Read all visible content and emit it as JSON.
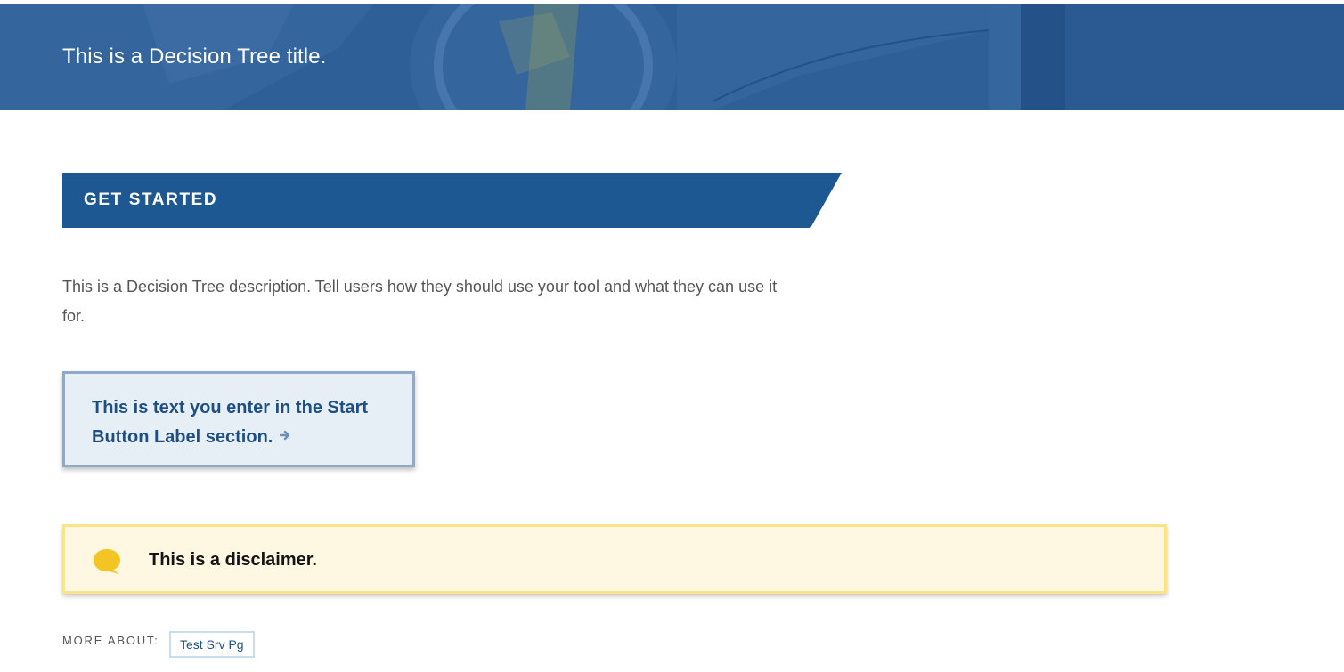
{
  "header": {
    "title": "This is a Decision Tree title."
  },
  "section_banner": {
    "label": "GET STARTED"
  },
  "description": "This is a Decision Tree description. Tell users how they should use your tool and what they can use it for.",
  "start_button": {
    "label": "This is text you enter in the Start Button Label section.",
    "icon": "arrow-right-icon"
  },
  "disclaimer": {
    "text": "This is a disclaimer.",
    "icon": "speech-bubble-icon"
  },
  "more_about": {
    "label": "MORE ABOUT:",
    "tags": [
      "Test Srv Pg"
    ]
  },
  "colors": {
    "header_blue": "#2d5e96",
    "banner_blue": "#1d5893",
    "button_text": "#1f4f82",
    "button_bg": "#e6eef6",
    "disclaimer_bg": "#fef8e3",
    "disclaimer_border": "#fae38a",
    "icon_yellow": "#f3c524"
  }
}
